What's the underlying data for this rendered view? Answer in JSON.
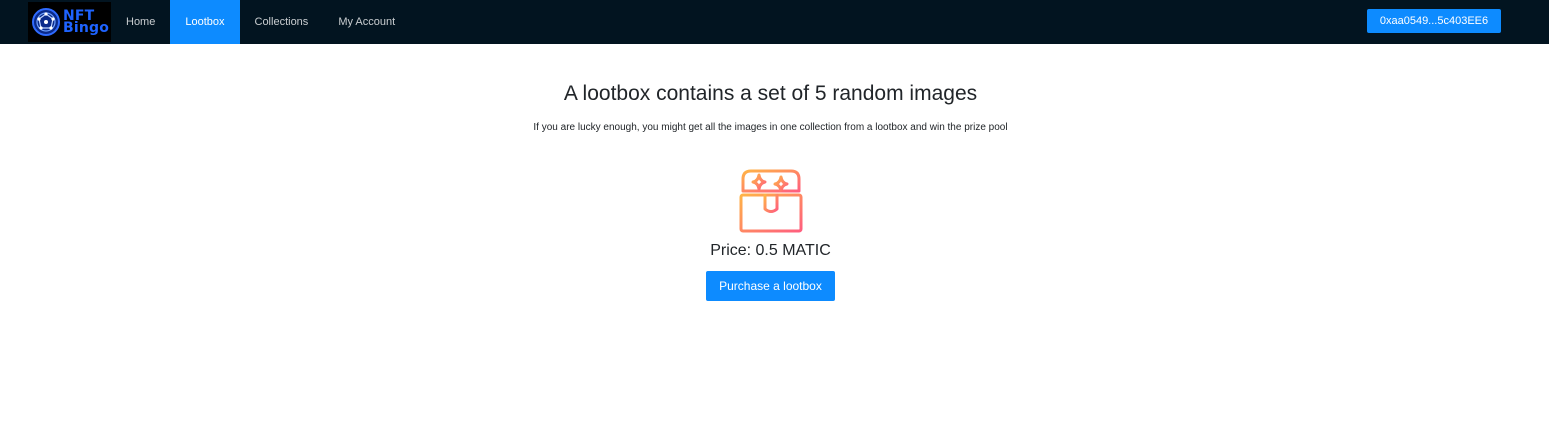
{
  "brand": {
    "line1": "NFT",
    "line2": "Bingo",
    "logo_icon": "globe-network-icon"
  },
  "nav": {
    "items": [
      {
        "label": "Home",
        "active": false
      },
      {
        "label": "Lootbox",
        "active": true
      },
      {
        "label": "Collections",
        "active": false
      },
      {
        "label": "My Account",
        "active": false
      }
    ],
    "wallet_label": "0xaa0549...5c403EE6"
  },
  "main": {
    "title": "A lootbox contains a set of 5 random images",
    "subtitle": "If you are lucky enough, you might get all the images in one collection from a lootbox and win the prize pool",
    "chest_icon": "treasure-chest-icon",
    "price_label": "Price: 0.5 MATIC",
    "purchase_label": "Purchase a lootbox"
  },
  "colors": {
    "navbar_bg": "#021420",
    "accent": "#0d8bff",
    "brand_text": "#1e63ff",
    "chest_gradient_start": "#ffb347",
    "chest_gradient_end": "#ff5e7e"
  }
}
